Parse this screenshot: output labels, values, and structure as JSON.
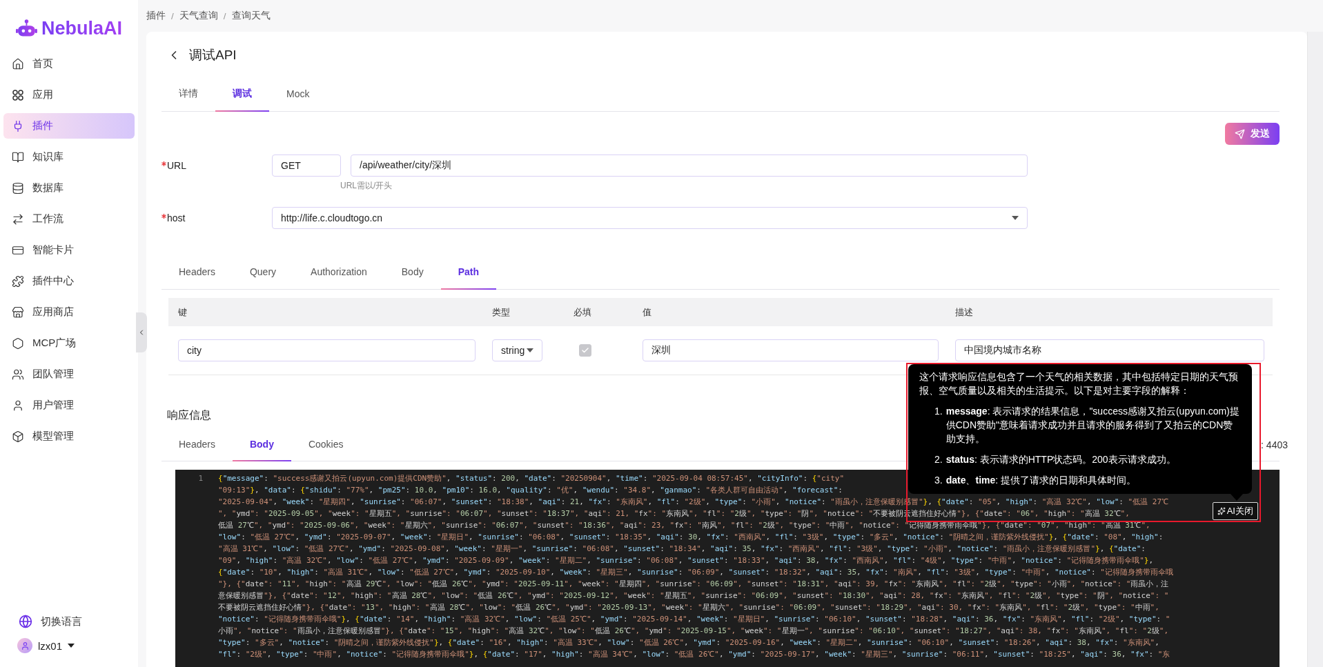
{
  "sidebar": {
    "logo": "NebulaAI",
    "items": [
      {
        "label": "首页",
        "selected": false
      },
      {
        "label": "应用",
        "selected": false
      },
      {
        "label": "插件",
        "selected": true
      },
      {
        "label": "知识库",
        "selected": false
      },
      {
        "label": "数据库",
        "selected": false
      },
      {
        "label": "工作流",
        "selected": false
      },
      {
        "label": "智能卡片",
        "selected": false
      },
      {
        "label": "插件中心",
        "selected": false
      },
      {
        "label": "应用商店",
        "selected": false
      },
      {
        "label": "MCP广场",
        "selected": false
      },
      {
        "label": "团队管理",
        "selected": false
      },
      {
        "label": "用户管理",
        "selected": false
      },
      {
        "label": "模型管理",
        "selected": false
      }
    ],
    "language": "切换语言",
    "user": "lzx01"
  },
  "breadcrumb": [
    "插件",
    "天气查询",
    "查询天气"
  ],
  "breadcrumb_separator": "/",
  "page": {
    "title": "调试API",
    "tabs": [
      {
        "label": "详情",
        "selected": false
      },
      {
        "label": "调试",
        "selected": true
      },
      {
        "label": "Mock",
        "selected": false
      }
    ],
    "send_button": "发送"
  },
  "request": {
    "url": {
      "label": "URL",
      "required": true,
      "method": "GET",
      "value": "/api/weather/city/深圳",
      "hint": "URL需以/开头"
    },
    "host": {
      "label": "host",
      "required": true,
      "value": "http://life.c.cloudtogo.cn"
    },
    "tabs": [
      {
        "label": "Headers",
        "selected": false
      },
      {
        "label": "Query",
        "selected": false
      },
      {
        "label": "Authorization",
        "selected": false
      },
      {
        "label": "Body",
        "selected": false
      },
      {
        "label": "Path",
        "selected": true
      }
    ],
    "params_table": {
      "columns": [
        "键",
        "类型",
        "必填",
        "值",
        "描述"
      ],
      "rows": [
        {
          "key": "city",
          "type": "string",
          "required": true,
          "value": "深圳",
          "description": "中国境内城市名称"
        }
      ]
    }
  },
  "response": {
    "title": "响应信息",
    "tabs": [
      {
        "label": "Headers",
        "selected": false
      },
      {
        "label": "Body",
        "selected": true
      },
      {
        "label": "Cookies",
        "selected": false
      }
    ],
    "meta": ": 4403",
    "code_lines": [
      {
        "number": "1",
        "text": "{\"message\": \"success感谢又拍云(upyun.com)提供CDN赞助\", \"status\": 200, \"date\": \"20250904\", \"time\": \"2025-09-04 08:57:45\", \"cityInfo\": {\"city\""
      },
      {
        "text": "\"09:13\"}, \"data\": {\"shidu\": \"77%\", \"pm25\": 10.0, \"pm10\": 16.0, \"quality\": \"优\", \"wendu\": \"34.8\", \"ganmao\": \"各类人群可自由活动\", \"forecast\":"
      },
      {
        "text": "\"2025-09-04\", \"week\": \"星期四\", \"sunrise\": \"06:07\", \"sunset\": \"18:38\", \"aqi\": 21, \"fx\": \"东南风\", \"fl\": \"2级\", \"type\": \"小雨\", \"notice\": \"雨虽小，注意保暖别感冒\"}, {\"date\": \"05\", \"high\": \"高温 32℃\", \"low\": \"低温 27℃"
      },
      {
        "text": "\", \"ymd\": \"2025-09-05\", \"week\": \"星期五\", \"sunrise\": \"06:07\", \"sunset\": \"18:37\", \"aqi\": 21, \"fx\": \"东南风\", \"fl\": \"2级\", \"type\": \"阴\", \"notice\": \"不要被阴云遮挡住好心情\"}, {\"date\": \"06\", \"high\": \"高温 32℃\","
      },
      {
        "text": "低温 27℃\", \"ymd\": \"2025-09-06\", \"week\": \"星期六\", \"sunrise\": \"06:07\", \"sunset\": \"18:36\", \"aqi\": 23, \"fx\": \"南风\", \"fl\": \"2级\", \"type\": \"中雨\", \"notice\": \"记得随身携带雨伞哦\"}, {\"date\": \"07\", \"high\": \"高温 31℃\","
      },
      {
        "text": "\"low\": \"低温 27℃\", \"ymd\": \"2025-09-07\", \"week\": \"星期日\", \"sunrise\": \"06:08\", \"sunset\": \"18:35\", \"aqi\": 30, \"fx\": \"西南风\", \"fl\": \"3级\", \"type\": \"多云\", \"notice\": \"阴晴之间，谨防紫外线侵扰\"}, {\"date\": \"08\", \"high\":"
      },
      {
        "text": "\"高温 31℃\", \"low\": \"低温 27℃\", \"ymd\": \"2025-09-08\", \"week\": \"星期一\", \"sunrise\": \"06:08\", \"sunset\": \"18:34\", \"aqi\": 35, \"fx\": \"西南风\", \"fl\": \"3级\", \"type\": \"小雨\", \"notice\": \"雨虽小，注意保暖别感冒\"}, {\"date\":"
      },
      {
        "text": "\"09\", \"high\": \"高温 32℃\", \"low\": \"低温 27℃\", \"ymd\": \"2025-09-09\", \"week\": \"星期二\", \"sunrise\": \"06:08\", \"sunset\": \"18:33\", \"aqi\": 38, \"fx\": \"西南风\", \"fl\": \"4级\", \"type\": \"中雨\", \"notice\": \"记得随身携带雨伞哦\"},"
      },
      {
        "text": "{\"date\": \"10\", \"high\": \"高温 31℃\", \"low\": \"低温 27℃\", \"ymd\": \"2025-09-10\", \"week\": \"星期三\", \"sunrise\": \"06:09\", \"sunset\": \"18:32\", \"aqi\": 35, \"fx\": \"南风\", \"fl\": \"3级\", \"type\": \"中雨\", \"notice\": \"记得随身携带雨伞哦"
      },
      {
        "text": "\"}, {\"date\": \"11\", \"high\": \"高温 29℃\", \"low\": \"低温 26℃\", \"ymd\": \"2025-09-11\", \"week\": \"星期四\", \"sunrise\": \"06:09\", \"sunset\": \"18:31\", \"aqi\": 39, \"fx\": \"东南风\", \"fl\": \"2级\", \"type\": \"小雨\", \"notice\": \"雨虽小，注"
      },
      {
        "text": "意保暖别感冒\"}, {\"date\": \"12\", \"high\": \"高温 28℃\", \"low\": \"低温 26℃\", \"ymd\": \"2025-09-12\", \"week\": \"星期五\", \"sunrise\": \"06:09\", \"sunset\": \"18:30\", \"aqi\": 28, \"fx\": \"东南风\", \"fl\": \"2级\", \"type\": \"阴\", \"notice\": \""
      },
      {
        "text": "不要被阴云遮挡住好心情\"}, {\"date\": \"13\", \"high\": \"高温 28℃\", \"low\": \"低温 26℃\", \"ymd\": \"2025-09-13\", \"week\": \"星期六\", \"sunrise\": \"06:09\", \"sunset\": \"18:29\", \"aqi\": 30, \"fx\": \"东南风\", \"fl\": \"2级\", \"type\": \"中雨\","
      },
      {
        "text": "\"notice\": \"记得随身携带雨伞哦\"}, {\"date\": \"14\", \"high\": \"高温 32℃\", \"low\": \"低温 25℃\", \"ymd\": \"2025-09-14\", \"week\": \"星期日\", \"sunrise\": \"06:10\", \"sunset\": \"18:28\", \"aqi\": 36, \"fx\": \"东南风\", \"fl\": \"2级\", \"type\": \""
      },
      {
        "text": "小雨\", \"notice\": \"雨虽小，注意保暖别感冒\"}, {\"date\": \"15\", \"high\": \"高温 32℃\", \"low\": \"低温 26℃\", \"ymd\": \"2025-09-15\", \"week\": \"星期一\", \"sunrise\": \"06:10\", \"sunset\": \"18:27\", \"aqi\": 38, \"fx\": \"东南风\", \"fl\": \"2级\","
      },
      {
        "text": "\"type\": \"多云\", \"notice\": \"阴晴之间，谨防紫外线侵扰\"}, {\"date\": \"16\", \"high\": \"高温 33℃\", \"low\": \"低温 26℃\", \"ymd\": \"2025-09-16\", \"week\": \"星期二\", \"sunrise\": \"06:10\", \"sunset\": \"18:26\", \"aqi\": 38, \"fx\": \"东南风\","
      },
      {
        "text": "\"fl\": \"2级\", \"type\": \"中雨\", \"notice\": \"记得随身携带雨伞哦\"}, {\"date\": \"17\", \"high\": \"高温 34℃\", \"low\": \"低温 26℃\", \"ymd\": \"2025-09-17\", \"week\": \"星期三\", \"sunrise\": \"06:11\", \"sunset\": \"18:25\", \"aqi\": 36, \"fx\": \"东"
      }
    ]
  },
  "ai_popover": {
    "intro": "这个请求响应信息包含了一个天气的相关数据，其中包括特定日期的天气预报、空气质量以及相关的生活提示。以下是对主要字段的解释：",
    "items": [
      {
        "number": "1.",
        "text": "**message**: 表示请求的结果信息，\"success感谢又拍云(upyun.com)提供CDN赞助\"意味着请求成功并且请求的服务得到了又拍云的CDN赞助支持。"
      },
      {
        "number": "2.",
        "text": "**status**: 表示请求的HTTP状态码。200表示请求成功。"
      },
      {
        "number": "3.",
        "text": "**date**、**time**: 提供了请求的日期和具体时间。"
      }
    ],
    "close_button": "AI关闭"
  }
}
